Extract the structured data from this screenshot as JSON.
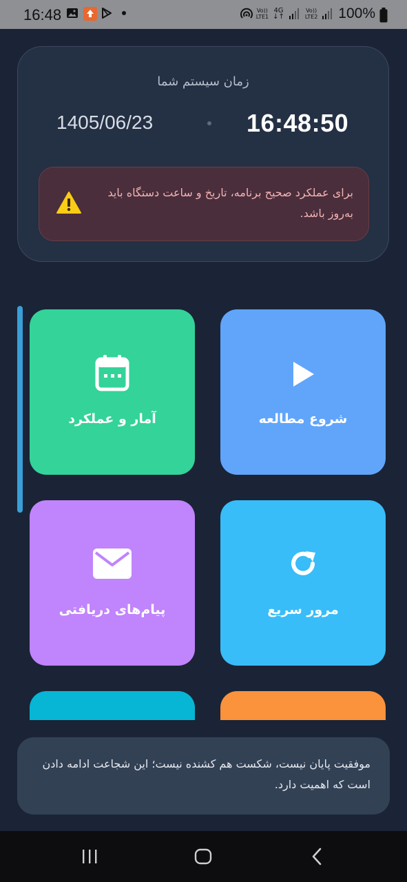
{
  "status_bar": {
    "time": "16:48",
    "sim1_top": "Vo))",
    "sim1_bottom": "LTE1",
    "network": "4G",
    "sim2_top": "Vo))",
    "sim2_bottom": "LTE2",
    "battery": "100%"
  },
  "time_card": {
    "title": "زمان سیستم شما",
    "time": "16:48:50",
    "date": "1405/06/23",
    "warning": "برای عملکرد صحیح برنامه، تاریخ و ساعت دستگاه باید به‌روز باشد."
  },
  "tiles": [
    {
      "label": "شروع مطالعه",
      "icon": "play-icon",
      "color": "#60a5fa"
    },
    {
      "label": "آمار و عملکرد",
      "icon": "calendar-icon",
      "color": "#34d399"
    },
    {
      "label": "مرور سریع",
      "icon": "refresh-icon",
      "color": "#38bdf8"
    },
    {
      "label": "پیام‌های دریافتی",
      "icon": "mail-icon",
      "color": "#c084fc"
    }
  ],
  "quote": "موفقیت پایان نیست، شکست هم کشنده نیست؛ این شجاعت ادامه دادن است که اهمیت دارد.",
  "colors": {
    "background": "#1a2436",
    "card": "#243044",
    "warning_bg": "#4a2e3b",
    "warning_text": "#f3b3b6"
  }
}
